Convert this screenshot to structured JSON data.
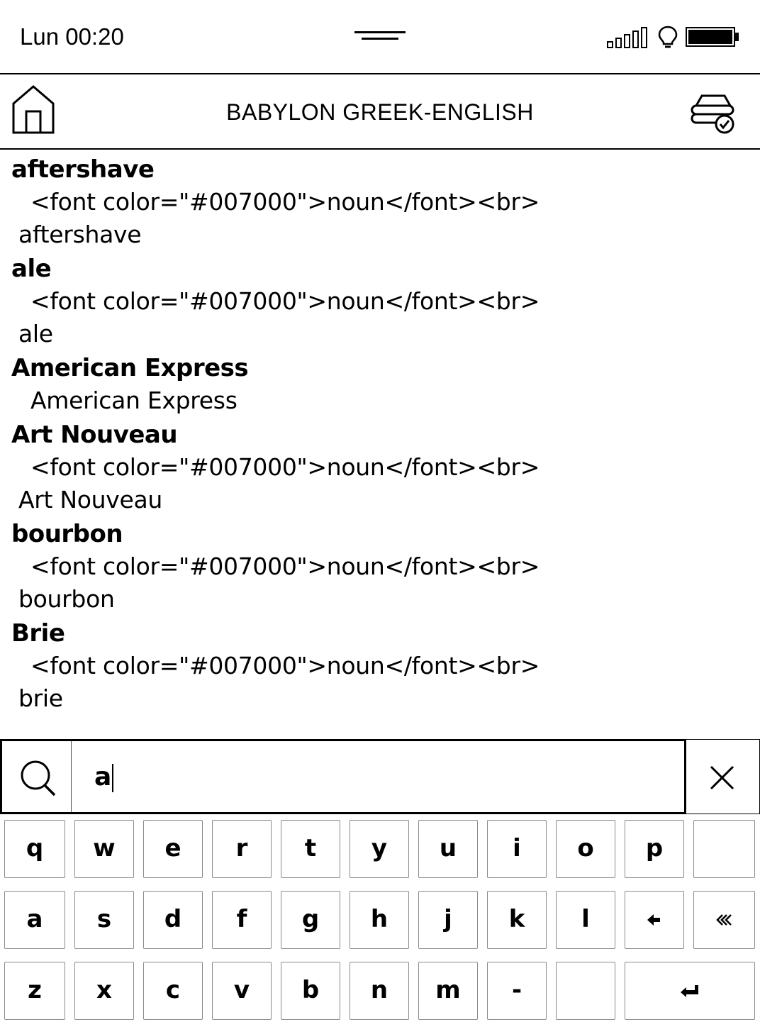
{
  "status_bar": {
    "time": "Lun 00:20",
    "battery_level": 1.0
  },
  "header": {
    "title": "BABYLON GREEK-ENGLISH"
  },
  "results": [
    {
      "headword": "aftershave",
      "line1": "<font color=\"#007000\">noun</font><br>",
      "line2": "aftershave"
    },
    {
      "headword": "ale",
      "line1": "<font color=\"#007000\">noun</font><br>",
      "line2": "ale"
    },
    {
      "headword": "American Express",
      "line1": "American Express"
    },
    {
      "headword": "Art Nouveau",
      "line1": "<font color=\"#007000\">noun</font><br>",
      "line2": "Art Nouveau"
    },
    {
      "headword": "bourbon",
      "line1": "<font color=\"#007000\">noun</font><br>",
      "line2": "bourbon"
    },
    {
      "headword": "Brie",
      "line1": "<font color=\"#007000\">noun</font><br>",
      "line2": "brie"
    }
  ],
  "search": {
    "value": "a"
  },
  "keyboard": {
    "row1": [
      "q",
      "w",
      "e",
      "r",
      "t",
      "y",
      "u",
      "i",
      "o",
      "p",
      ""
    ],
    "row2": [
      "a",
      "s",
      "d",
      "f",
      "g",
      "h",
      "j",
      "k",
      "l"
    ],
    "row3": [
      "z",
      "x",
      "c",
      "v",
      "b",
      "n",
      "m",
      "-",
      ""
    ],
    "icons": {
      "backspace": "backspace-arrow-icon",
      "shift": "double-chevron-left-icon",
      "enter": "enter-arrow-icon"
    }
  }
}
